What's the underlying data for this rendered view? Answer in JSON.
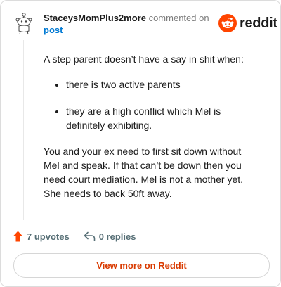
{
  "comment": {
    "author": "StaceysMomPlus2more",
    "action": "commented on",
    "post_link": "post",
    "avatar_icon": "snoo-avatar-icon",
    "body": {
      "intro": "A step parent doesn’t have a say in shit when:",
      "bullets": [
        "there is two active parents",
        "they are a high conflict which Mel is definitely exhibiting."
      ],
      "closing": "You and your ex need to first sit down without Mel and speak. If that can’t be down then you need court mediation. Mel is not a mother yet. She needs to back 50ft away."
    },
    "upvotes_label": "7 upvotes",
    "replies_label": "0 replies"
  },
  "brand": {
    "wordmark": "reddit",
    "logo_icon": "reddit-snoo-icon",
    "accent": "#ff4500"
  },
  "footer": {
    "view_more_label": "View more on Reddit"
  },
  "colors": {
    "link_blue": "#0079d3",
    "upvote_orange": "#ff4500",
    "view_more_text": "#d93a00",
    "muted": "#576f76"
  }
}
